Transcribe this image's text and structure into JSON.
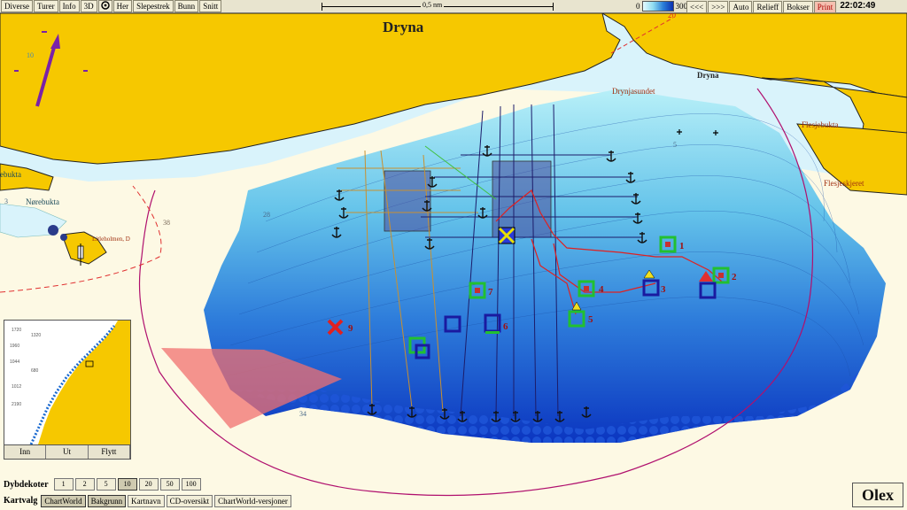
{
  "toolbar": {
    "buttons": [
      "Diverse",
      "Turer",
      "Info",
      "3D",
      "Her",
      "Slepestrek",
      "Bunn",
      "Snitt"
    ],
    "scale_label": "0,5 nm",
    "depth_min": "0",
    "depth_max": "300",
    "right_buttons": [
      "<<<",
      ">>>",
      "Auto",
      "Relieff",
      "Bokser"
    ],
    "print_label": "Print",
    "clock": "22:02:49"
  },
  "map": {
    "place_labels": {
      "dryna_main": "Dryna",
      "dryna_small": "Dryna",
      "drynjasundet": "Drynjasundet",
      "flesjebukta": "Flesjebukta",
      "flesjeskjeret": "Flesjeskjeret",
      "norebukta": "Nørebukta",
      "ebukta": "ebukta",
      "litleholmen": "Litleholmen, D"
    },
    "depth_numbers": [
      "20",
      "38",
      "28",
      "34",
      "5",
      "3",
      "10"
    ],
    "marker_labels": [
      "1",
      "2",
      "3",
      "4",
      "5",
      "6",
      "7",
      "9"
    ]
  },
  "minimap": {
    "buttons": [
      "Inn",
      "Ut",
      "Flytt"
    ],
    "depth_values": [
      "1720",
      "1320",
      "1960",
      "1044",
      "680",
      "1012",
      "2190"
    ]
  },
  "depth_contours": {
    "label": "Dybdekoter",
    "values": [
      "1",
      "2",
      "5",
      "10",
      "20",
      "50",
      "100"
    ],
    "active": "10"
  },
  "chart_select": {
    "label": "Kartvalg",
    "buttons": [
      "ChartWorld",
      "Bakgrunn",
      "Kartnavn",
      "CD-oversikt",
      "ChartWorld-versjoner"
    ],
    "active": [
      "ChartWorld",
      "Bakgrunn"
    ]
  },
  "logo": "Olex",
  "colors": {
    "land": "#f6c800",
    "shallow": "#bdeff8",
    "deep": "#0a2fb0",
    "track_red": "#e02020",
    "marker_green": "#22c030",
    "marker_blue": "#1a1aa0",
    "warning_red": "#f07070",
    "course_arrow": "#7a22a8"
  }
}
